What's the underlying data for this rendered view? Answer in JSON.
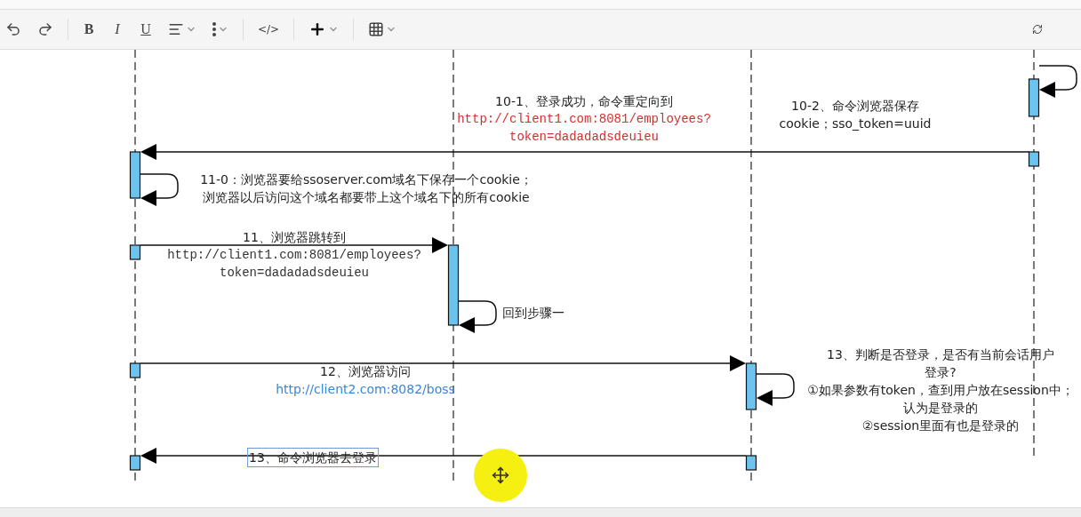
{
  "toolbar": {
    "items": [
      {
        "kind": "undo",
        "dropdown": false
      },
      {
        "kind": "redo",
        "dropdown": false
      },
      {
        "kind": "separator"
      },
      {
        "kind": "bold",
        "label": "B",
        "dropdown": false
      },
      {
        "kind": "italic",
        "label": "I",
        "dropdown": false
      },
      {
        "kind": "underline",
        "label": "U",
        "dropdown": false
      },
      {
        "kind": "align",
        "dropdown": true
      },
      {
        "kind": "more",
        "dropdown": true
      },
      {
        "kind": "separator"
      },
      {
        "kind": "code",
        "label": "</>",
        "dropdown": false
      },
      {
        "kind": "separator"
      },
      {
        "kind": "insert",
        "dropdown": true
      },
      {
        "kind": "separator"
      },
      {
        "kind": "table",
        "dropdown": true
      }
    ],
    "sync": {
      "kind": "sync"
    }
  },
  "diagram": {
    "labels": [
      {
        "selected": false,
        "lines": [
          {
            "kind": "text",
            "text": "10-1、登录成功，命令重定向到"
          },
          {
            "kind": "code",
            "text": "http://client1.com:8081/employees?",
            "color": "#d03030"
          },
          {
            "kind": "code",
            "text": "token=dadadadsdeuieu",
            "color": "#d03030"
          }
        ]
      },
      {
        "selected": false,
        "lines": [
          {
            "kind": "text",
            "text": "10-2、命令浏览器保存"
          },
          {
            "kind": "text",
            "text": "cookie；sso_token=uuid"
          }
        ]
      },
      {
        "selected": false,
        "lines": [
          {
            "kind": "text",
            "text": "11-0：浏览器要给ssoserver.com域名下保存一个cookie；"
          },
          {
            "kind": "text",
            "text": "浏览器以后访问这个域名都要带上这个域名下的所有cookie"
          }
        ]
      },
      {
        "selected": false,
        "lines": [
          {
            "kind": "text",
            "text": "11、浏览器跳转到"
          },
          {
            "kind": "code",
            "text": "http://client1.com:8081/employees?",
            "color": "#333333"
          },
          {
            "kind": "code",
            "text": "token=dadadadsdeuieu",
            "color": "#333333"
          }
        ]
      },
      {
        "selected": false,
        "lines": [
          {
            "kind": "text",
            "text": "回到步骤一"
          }
        ]
      },
      {
        "selected": false,
        "lines": [
          {
            "kind": "text",
            "text": "12、浏览器访问"
          },
          {
            "kind": "link",
            "text": "http://client2.com:8082/boss",
            "color": "#3a86d8"
          }
        ]
      },
      {
        "selected": false,
        "lines": [
          {
            "kind": "text",
            "text": "13、判断是否登录，是否有当前会话用户"
          },
          {
            "kind": "text",
            "text": "登录?"
          },
          {
            "kind": "text",
            "text": "①如果参数有token，查到用户放在session中；"
          },
          {
            "kind": "text",
            "text": "认为是登录的"
          },
          {
            "kind": "text",
            "text": "②session里面有也是登录的"
          }
        ]
      },
      {
        "selected": true,
        "lines": [
          {
            "kind": "text",
            "text": "13、命令浏览器去登录"
          }
        ]
      }
    ]
  }
}
